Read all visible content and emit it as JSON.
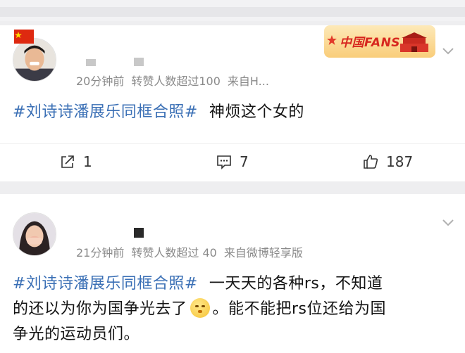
{
  "posts": [
    {
      "meta": {
        "time": "20分钟前",
        "reposts": "转赞人数超过100",
        "source": "来自H..."
      },
      "body": {
        "topic": "#刘诗诗潘展乐同框合照#",
        "text": "神烦这个女的"
      },
      "badge": {
        "label": "中国FANS"
      },
      "actions": {
        "share_count": "1",
        "comment_count": "7",
        "like_count": "187"
      }
    },
    {
      "meta": {
        "time": "21分钟前",
        "reposts": "转赞人数超过 40",
        "source": "来自微博轻享版"
      },
      "body": {
        "topic": "#刘诗诗潘展乐同框合照#",
        "text_part1": "一天天的各种rs，不知道",
        "text_part2": "的还以为你为国争光去了",
        "text_part3": "。能不能把rs位还给为国",
        "text_part4": "争光的运动员们。"
      }
    }
  ],
  "icons": [
    "share-icon",
    "comment-icon",
    "like-icon",
    "chevron-down-icon",
    "china-flag-icon",
    "shushing-emoji-icon"
  ],
  "colors": {
    "topic": "#3a6fb5",
    "meta": "#8a8a8a",
    "background": "#eeeef0",
    "card": "#ffffff"
  }
}
